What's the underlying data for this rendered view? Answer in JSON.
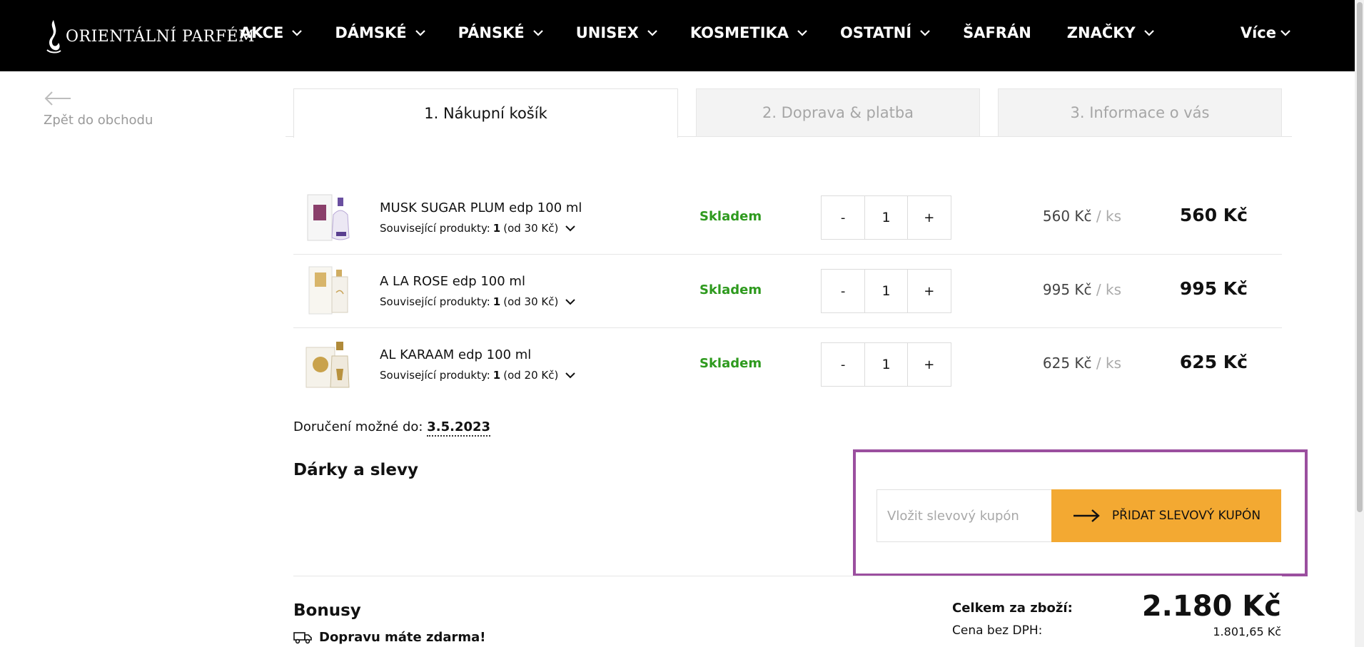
{
  "header": {
    "logo_text": "ORIENTÁLNÍ PARFÉM",
    "nav": [
      {
        "label": "AKCE",
        "has_dropdown": true
      },
      {
        "label": "DÁMSKÉ",
        "has_dropdown": true
      },
      {
        "label": "PÁNSKÉ",
        "has_dropdown": true
      },
      {
        "label": "UNISEX",
        "has_dropdown": true
      },
      {
        "label": "KOSMETIKA",
        "has_dropdown": true
      },
      {
        "label": "OSTATNÍ",
        "has_dropdown": true
      },
      {
        "label": "ŠAFRÁN",
        "has_dropdown": false
      },
      {
        "label": "ZNAČKY",
        "has_dropdown": true
      }
    ],
    "more_label": "Více"
  },
  "back": {
    "label": "Zpět do obchodu",
    "icon": "arrow-left-icon"
  },
  "tabs": [
    {
      "label": "1. Nákupní košík",
      "active": true
    },
    {
      "label": "2. Doprava & platba",
      "active": false
    },
    {
      "label": "3. Informace o vás",
      "active": false
    }
  ],
  "cart": {
    "items": [
      {
        "name": "MUSK SUGAR PLUM edp 100 ml",
        "related_prefix": "Související produkty:",
        "related_count": "1",
        "related_from": "(od 30 Kč)",
        "stock": "Skladem",
        "quantity": "1",
        "unit_price": "560 Kč",
        "unit_suffix": "/ ks",
        "total": "560 Kč"
      },
      {
        "name": "A LA ROSE edp 100 ml",
        "related_prefix": "Související produkty:",
        "related_count": "1",
        "related_from": "(od 30 Kč)",
        "stock": "Skladem",
        "quantity": "1",
        "unit_price": "995 Kč",
        "unit_suffix": "/ ks",
        "total": "995 Kč"
      },
      {
        "name": "AL KARAAM edp 100 ml",
        "related_prefix": "Související produkty:",
        "related_count": "1",
        "related_from": "(od 20 Kč)",
        "stock": "Skladem",
        "quantity": "1",
        "unit_price": "625 Kč",
        "unit_suffix": "/ ks",
        "total": "625 Kč"
      }
    ],
    "minus_label": "-",
    "plus_label": "+"
  },
  "delivery": {
    "label": "Doručení možné do:",
    "date": "3.5.2023"
  },
  "gifts": {
    "title": "Dárky a slevy"
  },
  "coupon": {
    "placeholder": "Vložit slevový kupón",
    "button_label": "PŘIDAT SLEVOVÝ KUPÓN"
  },
  "bonus": {
    "title": "Bonusy",
    "free_shipping": "Dopravu máte zdarma!"
  },
  "summary": {
    "total_label": "Celkem za zboží:",
    "total_value": "2.180 Kč",
    "vat_label": "Cena bez DPH:",
    "vat_value": "1.801,65 Kč"
  },
  "colors": {
    "header_bg": "#000000",
    "stock_green": "#2e9a1e",
    "coupon_button": "#f3a932",
    "highlight_border": "#9b4f9f"
  }
}
